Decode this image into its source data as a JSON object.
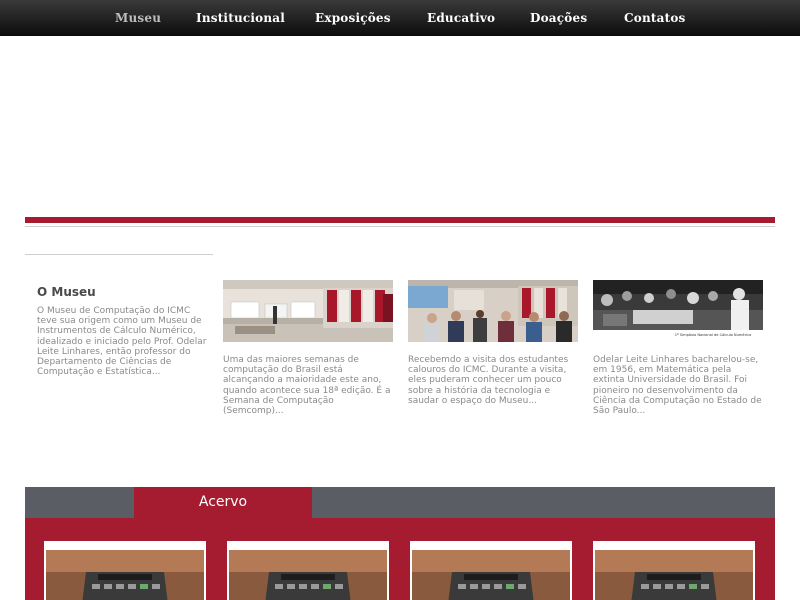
{
  "nav": {
    "items": [
      {
        "label": "Museu",
        "active": true
      },
      {
        "label": "Institucional",
        "active": false
      },
      {
        "label": "Exposições",
        "active": false
      },
      {
        "label": "Educativo",
        "active": false
      },
      {
        "label": "Doações",
        "active": false
      },
      {
        "label": "Contatos",
        "active": false
      }
    ]
  },
  "intro": {
    "title": "O Museu",
    "text": "O Museu de Computação do ICMC teve sua origem como um Museu de Instrumentos de Cálculo Numérico, idealizado e iniciado pelo Prof. Odelar Leite Linhares, então professor do Departamento de Ciências de Computação e Estatística..."
  },
  "cards": [
    {
      "image": "exhibition-hall-photo",
      "text": "Uma das maiores semanas de computação do Brasil está alcançando a maioridade este ano, quando acontece sua 18ª edição. É a Semana de Computação (Semcomp)..."
    },
    {
      "image": "students-visit-photo",
      "text": "Recebemdo a visita dos estudantes calouros do ICMC. Durante a visita, eles puderam conhecer um pouco sobre a história da tecnologia e saudar o espaço do Museu..."
    },
    {
      "image": "historic-photo",
      "caption": "1º Simpósio Nacional de Cálculo Numérico",
      "text": "Odelar Leite Linhares bacharelou-se, em 1956, em Matemática pela extinta Universidade do Brasil. Foi pioneiro no desenvolvimento da Ciência da Computação no Estado de São Paulo..."
    }
  ],
  "acervo": {
    "title": "Acervo",
    "items": [
      {
        "image": "calculator-photo"
      },
      {
        "image": "calculator-photo"
      },
      {
        "image": "calculator-photo"
      },
      {
        "image": "calculator-photo"
      }
    ]
  },
  "colors": {
    "brand_red": "#a51c30",
    "nav_bg": "#1a1a1a",
    "section_gray": "#5a5d63"
  }
}
